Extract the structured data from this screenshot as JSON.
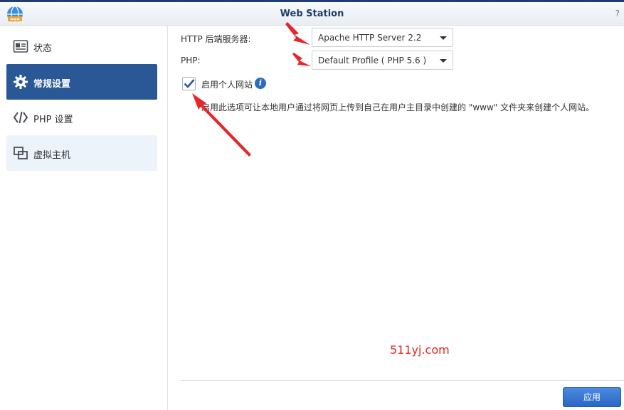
{
  "window": {
    "title": "Web Station",
    "help_icon": "?"
  },
  "sidebar": {
    "items": [
      {
        "label": "状态",
        "icon": "status-card-icon"
      },
      {
        "label": "常规设置",
        "icon": "gear-icon",
        "active": true
      },
      {
        "label": "PHP 设置",
        "icon": "code-icon"
      },
      {
        "label": "虚拟主机",
        "icon": "virtual-host-icon"
      }
    ]
  },
  "settings": {
    "http_label": "HTTP 后端服务器:",
    "http_value": "Apache HTTP Server 2.2",
    "php_label": "PHP:",
    "php_value": "Default Profile ( PHP 5.6 )",
    "checkbox_label": "启用个人网站",
    "checkbox_checked": true,
    "description": "启用此选项可让本地用户通过将网页上传到自己在用户主目录中创建的 \"www\" 文件夹来创建个人网站。"
  },
  "watermark": "511yj.com",
  "footer": {
    "apply_label": "应用"
  },
  "colors": {
    "accent": "#2a5796",
    "annotation_arrow": "#e8262a",
    "link_blue": "#2d6cc0"
  }
}
